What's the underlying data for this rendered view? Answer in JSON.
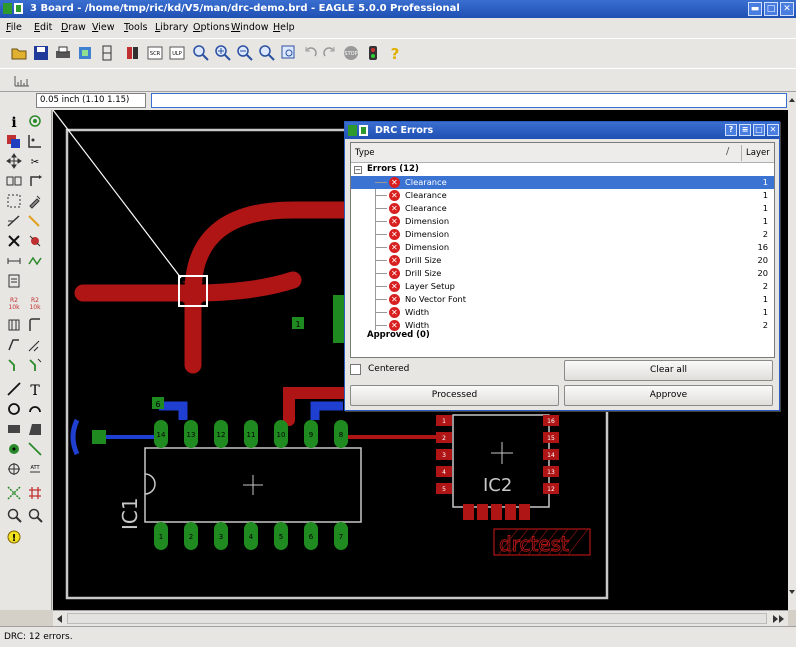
{
  "window": {
    "title": "3 Board - /home/tmp/ric/kd/V5/man/drc-demo.brd - EAGLE 5.0.0 Professional"
  },
  "menu": [
    "File",
    "Edit",
    "Draw",
    "View",
    "Tools",
    "Library",
    "Options",
    "Window",
    "Help"
  ],
  "command": {
    "coordinate": "0.05 inch (1.10 1.15)",
    "input": ""
  },
  "board": {
    "labels": {
      "ic1": "IC1",
      "ic2": "IC2",
      "drctest": "drctest"
    },
    "ic1_top_pins": [
      "14",
      "13",
      "12",
      "11",
      "10",
      "9",
      "8"
    ],
    "ic1_bottom_pins": [
      "1",
      "2",
      "3",
      "4",
      "5",
      "6",
      "7"
    ],
    "ic2_left_pins": [
      "1",
      "2",
      "3",
      "4",
      "5"
    ],
    "ic2_right_pins": [
      "16",
      "15",
      "14",
      "13",
      "12"
    ],
    "misc_pads": [
      "6",
      "1"
    ],
    "colors": {
      "background": "#000000",
      "top_copper": "#b01515",
      "bottom_copper": "#1f3fd0",
      "pads": "#1f8a1f",
      "outline": "#c8c8c8",
      "selection": "#ffffff"
    }
  },
  "drc": {
    "title": "DRC Errors",
    "columns": {
      "type": "Type",
      "layer": "Layer"
    },
    "errors_group": "Errors (12)",
    "approved_group": "Approved (0)",
    "errors": [
      {
        "label": "Clearance",
        "layer": "1",
        "selected": true
      },
      {
        "label": "Clearance",
        "layer": "1",
        "selected": false
      },
      {
        "label": "Clearance",
        "layer": "1",
        "selected": false
      },
      {
        "label": "Dimension",
        "layer": "1",
        "selected": false
      },
      {
        "label": "Dimension",
        "layer": "2",
        "selected": false
      },
      {
        "label": "Dimension",
        "layer": "16",
        "selected": false
      },
      {
        "label": "Drill Size",
        "layer": "20",
        "selected": false
      },
      {
        "label": "Drill Size",
        "layer": "20",
        "selected": false
      },
      {
        "label": "Layer Setup",
        "layer": "2",
        "selected": false
      },
      {
        "label": "No Vector Font",
        "layer": "1",
        "selected": false
      },
      {
        "label": "Width",
        "layer": "1",
        "selected": false
      },
      {
        "label": "Width",
        "layer": "2",
        "selected": false
      }
    ],
    "centered_label": "Centered",
    "clear_all_label": "Clear all",
    "processed_label": "Processed",
    "approve_label": "Approve",
    "title_buttons": [
      "?",
      "≡",
      "□",
      "✕"
    ]
  },
  "status": "DRC: 12 errors."
}
